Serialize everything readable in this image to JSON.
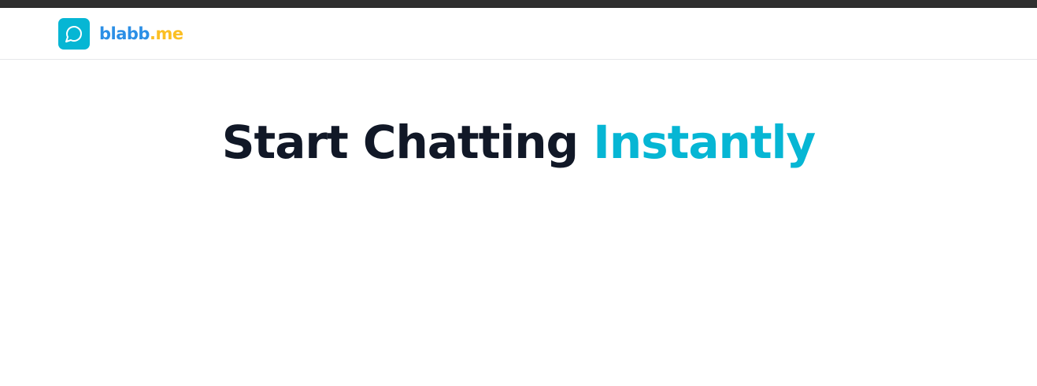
{
  "brand": {
    "name_main": "blabb",
    "name_suffix": ".me",
    "logo_icon": "chat-bubble-icon",
    "colors": {
      "logo_bg": "#06b6d4",
      "name_main": "#2b8fe6",
      "name_suffix": "#fbbf24"
    }
  },
  "hero": {
    "title_main": "Start Chatting",
    "title_accent": "Instantly",
    "colors": {
      "main": "#111827",
      "accent": "#06b6d4"
    }
  },
  "colors": {
    "top_strip": "#2f2f2f",
    "background": "#ffffff",
    "divider": "#e6e7ea"
  }
}
